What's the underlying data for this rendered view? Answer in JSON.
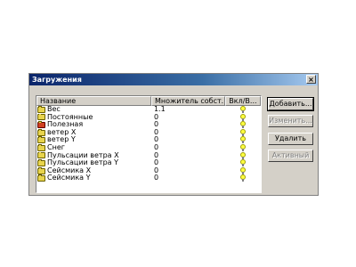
{
  "window": {
    "title": "Загружения",
    "close_label": "×"
  },
  "table": {
    "columns": [
      "Название",
      "Множитель собст...",
      "Вкл/В..."
    ],
    "rows": [
      {
        "name": "Вес",
        "multiplier": "1.1",
        "icon": "folder-icon"
      },
      {
        "name": "Постоянные",
        "multiplier": "0",
        "icon": "folder-icon"
      },
      {
        "name": "Полезная",
        "multiplier": "0",
        "icon": "folder-red-icon"
      },
      {
        "name": "ветер X",
        "multiplier": "0",
        "icon": "folder-icon"
      },
      {
        "name": "ветер Y",
        "multiplier": "0",
        "icon": "folder-icon"
      },
      {
        "name": "Снег",
        "multiplier": "0",
        "icon": "folder-icon"
      },
      {
        "name": "Пульсации ветра X",
        "multiplier": "0",
        "icon": "folder-icon"
      },
      {
        "name": "Пульсации ветра Y",
        "multiplier": "0",
        "icon": "folder-icon"
      },
      {
        "name": "Сейсмика X",
        "multiplier": "0",
        "icon": "folder-icon"
      },
      {
        "name": "Сейсмика Y",
        "multiplier": "0",
        "icon": "folder-icon"
      }
    ]
  },
  "buttons": {
    "add": "Добавить...",
    "edit": "Изменить...",
    "delete": "Удалить",
    "active": "Активный"
  }
}
